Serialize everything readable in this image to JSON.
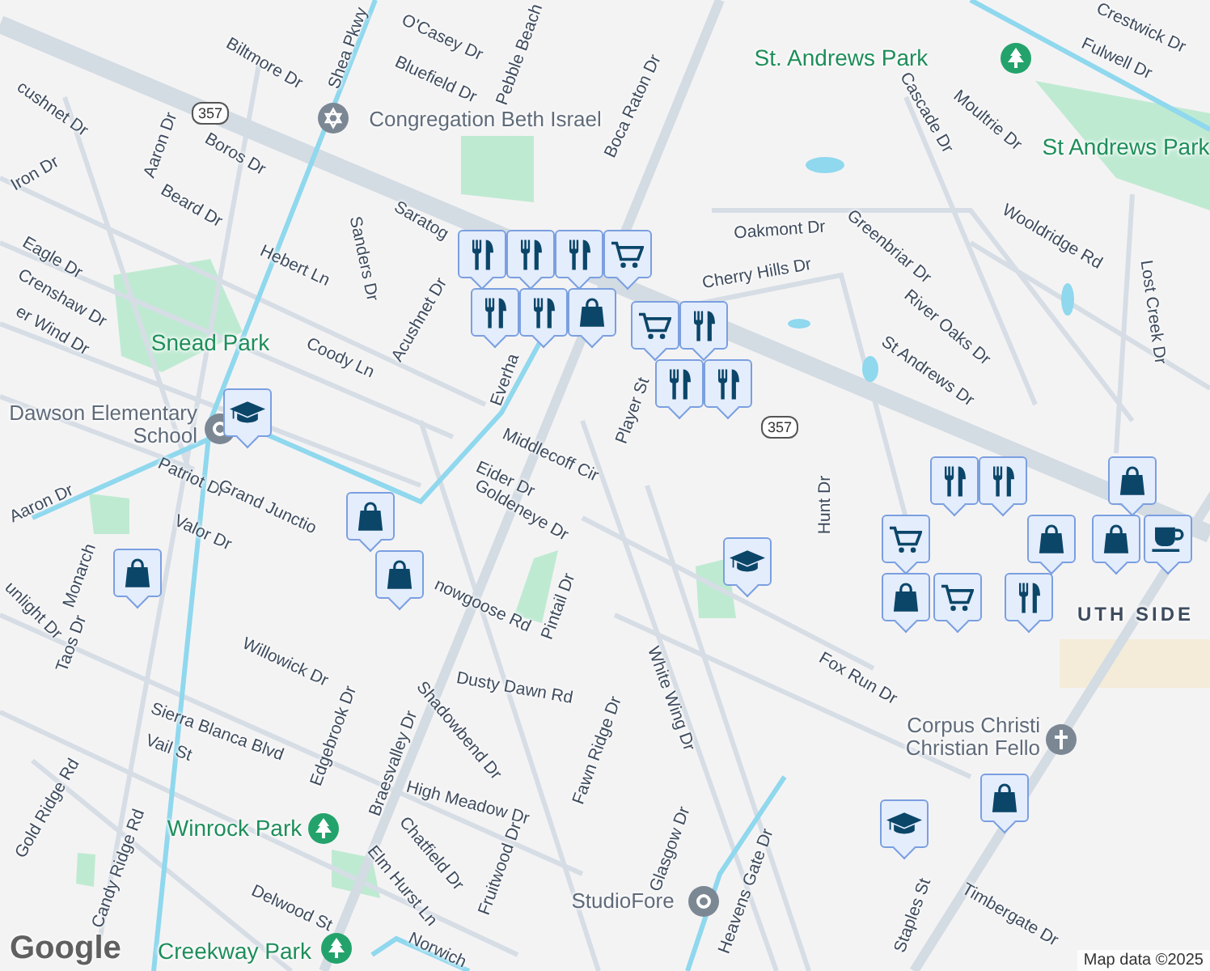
{
  "map": {
    "labels": [
      {
        "text": "Biltmore Dr",
        "kind": "street"
      },
      {
        "text": "Shea Pkwy",
        "kind": "street"
      },
      {
        "text": "O'Casey Dr",
        "kind": "street"
      },
      {
        "text": "Bluefield Dr",
        "kind": "street"
      },
      {
        "text": "Pebble Beach",
        "kind": "street"
      },
      {
        "text": "cushnet Dr",
        "kind": "street"
      },
      {
        "text": "Aaron Dr",
        "kind": "street"
      },
      {
        "text": "Boros Dr",
        "kind": "street"
      },
      {
        "text": "Iron Dr",
        "kind": "street"
      },
      {
        "text": "Beard Dr",
        "kind": "street"
      },
      {
        "text": "Hebert Ln",
        "kind": "street"
      },
      {
        "text": "Sanders Dr",
        "kind": "street"
      },
      {
        "text": "Eagle Dr",
        "kind": "street"
      },
      {
        "text": "Crenshaw Dr",
        "kind": "street"
      },
      {
        "text": "er Wind Dr",
        "kind": "street"
      },
      {
        "text": "Snead Park",
        "kind": "park"
      },
      {
        "text": "Coody Ln",
        "kind": "street"
      },
      {
        "text": "Acushnet Dr",
        "kind": "street"
      },
      {
        "text": "Dawson Elementary School",
        "kind": "poi"
      },
      {
        "text": "Saratog",
        "kind": "street"
      },
      {
        "text": "Everha",
        "kind": "street"
      },
      {
        "text": "Middlecoff Cir",
        "kind": "street"
      },
      {
        "text": "Eider Dr",
        "kind": "street"
      },
      {
        "text": "Congregation Beth Israel",
        "kind": "poi"
      },
      {
        "text": "Boca Raton Dr",
        "kind": "street"
      },
      {
        "text": "St. Andrews Park",
        "kind": "park"
      },
      {
        "text": "Crestwick Dr",
        "kind": "street"
      },
      {
        "text": "Fulwell Dr",
        "kind": "street"
      },
      {
        "text": "Cascade Dr",
        "kind": "street"
      },
      {
        "text": "Moultrie Dr",
        "kind": "street"
      },
      {
        "text": "St Andrews Park",
        "kind": "park"
      },
      {
        "text": "Oakmont Dr",
        "kind": "street"
      },
      {
        "text": "Greenbriar Dr",
        "kind": "street"
      },
      {
        "text": "Wooldridge Rd",
        "kind": "street"
      },
      {
        "text": "Cherry Hills Dr",
        "kind": "street"
      },
      {
        "text": "River Oaks Dr",
        "kind": "street"
      },
      {
        "text": "St Andrews Dr",
        "kind": "street"
      },
      {
        "text": "Lost Creek Dr",
        "kind": "street"
      },
      {
        "text": "Player St",
        "kind": "street"
      },
      {
        "text": "Hunt Dr",
        "kind": "street"
      },
      {
        "text": "Patriot Dr",
        "kind": "street"
      },
      {
        "text": "Grand Junctio",
        "kind": "street"
      },
      {
        "text": "Aaron Dr",
        "kind": "street"
      },
      {
        "text": "Valor Dr",
        "kind": "street"
      },
      {
        "text": "Goldeneye Dr",
        "kind": "street"
      },
      {
        "text": "Monarch",
        "kind": "street"
      },
      {
        "text": "unlight Dr",
        "kind": "street"
      },
      {
        "text": "nowgoose Rd",
        "kind": "street"
      },
      {
        "text": "Pintail Dr",
        "kind": "street"
      },
      {
        "text": "Willowick Dr",
        "kind": "street"
      },
      {
        "text": "Dusty Dawn Rd",
        "kind": "street"
      },
      {
        "text": "Taos Dr",
        "kind": "street"
      },
      {
        "text": "Sierra Blanca Blvd",
        "kind": "street"
      },
      {
        "text": "Vail St",
        "kind": "street"
      },
      {
        "text": "Edgebrook Dr",
        "kind": "street"
      },
      {
        "text": "Shadowbend Dr",
        "kind": "street"
      },
      {
        "text": "Fawn Ridge Dr",
        "kind": "street"
      },
      {
        "text": "Braesvalley Dr",
        "kind": "street"
      },
      {
        "text": "High Meadow Dr",
        "kind": "street"
      },
      {
        "text": "Gold Ridge Rd",
        "kind": "street"
      },
      {
        "text": "Candy Ridge Rd",
        "kind": "street"
      },
      {
        "text": "Winrock Park",
        "kind": "park"
      },
      {
        "text": "Chatfield Dr",
        "kind": "street"
      },
      {
        "text": "Elm Hurst Ln",
        "kind": "street"
      },
      {
        "text": "Fruitwood Dr",
        "kind": "street"
      },
      {
        "text": "Delwood St",
        "kind": "street"
      },
      {
        "text": "Creekway Park",
        "kind": "park"
      },
      {
        "text": "Norwich",
        "kind": "street"
      },
      {
        "text": "Fox Run Dr",
        "kind": "street"
      },
      {
        "text": "White Wing Dr",
        "kind": "street"
      },
      {
        "text": "Corpus Christi Christian Fello",
        "kind": "poi"
      },
      {
        "text": "Glasgow Dr",
        "kind": "street"
      },
      {
        "text": "Heavens Gate Dr",
        "kind": "street"
      },
      {
        "text": "StudioFore",
        "kind": "poi"
      },
      {
        "text": "Staples St",
        "kind": "street"
      },
      {
        "text": "Timbergate Dr",
        "kind": "street"
      },
      {
        "text": "UTH SIDE",
        "kind": "area"
      }
    ],
    "shields": [
      "357",
      "357"
    ],
    "pins": [
      {
        "kind": "restaurant"
      },
      {
        "kind": "restaurant"
      },
      {
        "kind": "restaurant"
      },
      {
        "kind": "grocery"
      },
      {
        "kind": "restaurant"
      },
      {
        "kind": "restaurant"
      },
      {
        "kind": "shopping"
      },
      {
        "kind": "grocery"
      },
      {
        "kind": "restaurant"
      },
      {
        "kind": "restaurant"
      },
      {
        "kind": "restaurant"
      },
      {
        "kind": "school"
      },
      {
        "kind": "shopping"
      },
      {
        "kind": "shopping"
      },
      {
        "kind": "shopping"
      },
      {
        "kind": "school"
      },
      {
        "kind": "restaurant"
      },
      {
        "kind": "restaurant"
      },
      {
        "kind": "grocery"
      },
      {
        "kind": "grocery"
      },
      {
        "kind": "shopping"
      },
      {
        "kind": "shopping"
      },
      {
        "kind": "restaurant"
      },
      {
        "kind": "shopping"
      },
      {
        "kind": "shopping"
      },
      {
        "kind": "cafe"
      },
      {
        "kind": "shopping"
      },
      {
        "kind": "school"
      }
    ],
    "logo": "Google",
    "attribution": "Map data ©2025"
  }
}
